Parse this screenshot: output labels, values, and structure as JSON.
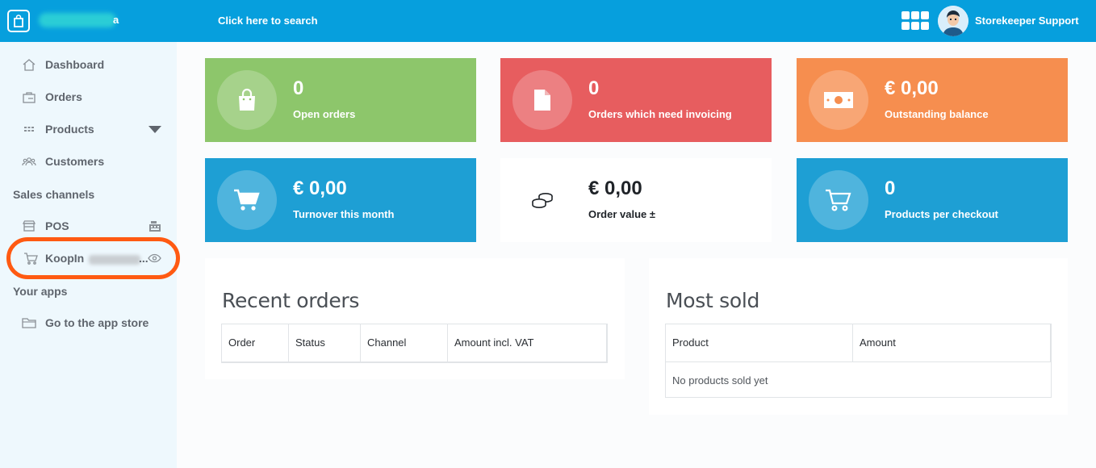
{
  "header": {
    "store_name_suffix": "a",
    "search_label": "Click here to search",
    "user_name": "Storekeeper Support"
  },
  "sidebar": {
    "items": [
      {
        "label": "Dashboard",
        "icon": "home-icon"
      },
      {
        "label": "Orders",
        "icon": "orders-icon"
      },
      {
        "label": "Products",
        "icon": "products-icon"
      },
      {
        "label": "Customers",
        "icon": "customers-icon"
      }
    ],
    "sales_channels_title": "Sales channels",
    "channels": [
      {
        "label": "POS",
        "icon": "store-icon",
        "right_icon": "cash-register-icon"
      },
      {
        "label": "KoopIn",
        "suffix": "...",
        "icon": "cart-icon",
        "right_icon": "eye-icon"
      }
    ],
    "your_apps_title": "Your apps",
    "apps": [
      {
        "label": "Go to the app store",
        "icon": "folder-icon"
      }
    ]
  },
  "stats": [
    {
      "value": "0",
      "caption": "Open orders",
      "color": "#8dc66b",
      "icon": "shopping-bag-icon"
    },
    {
      "value": "0",
      "caption": "Orders which need invoicing",
      "color": "#e75d5f",
      "icon": "document-icon"
    },
    {
      "value": "€ 0,00",
      "caption": "Outstanding balance",
      "color": "#f68e4f",
      "icon": "banknote-icon"
    },
    {
      "value": "€ 0,00",
      "caption": "Turnover this month",
      "color": "#1e9fd4",
      "icon": "shopping-cart-icon"
    },
    {
      "value": "€ 0,00",
      "caption": "Order value ±",
      "color": "#ffffff",
      "icon": "coins-icon"
    },
    {
      "value": "0",
      "caption": "Products per checkout",
      "color": "#1e9fd4",
      "icon": "cart-outline-icon"
    }
  ],
  "recent_orders": {
    "title": "Recent orders",
    "columns": [
      "Order",
      "Status",
      "Channel",
      "Amount incl. VAT"
    ]
  },
  "most_sold": {
    "title": "Most sold",
    "columns": [
      "Product",
      "Amount"
    ],
    "empty_text": "No products sold yet"
  }
}
